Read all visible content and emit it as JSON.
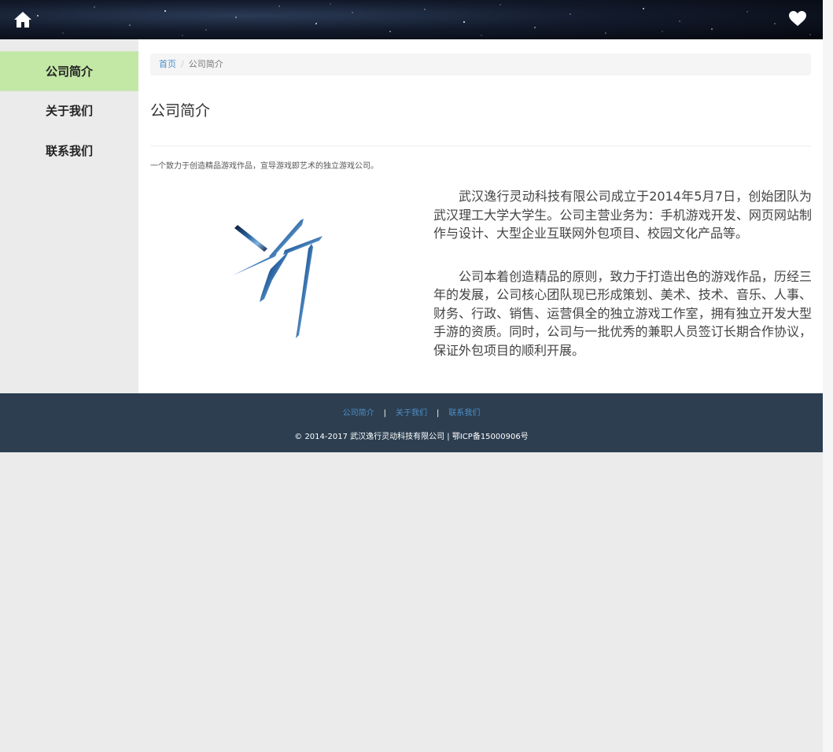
{
  "header": {
    "home_icon": "home-icon",
    "heart_icon": "heart-icon"
  },
  "sidebar": {
    "items": [
      {
        "label": "公司简介",
        "active": true
      },
      {
        "label": "关于我们",
        "active": false
      },
      {
        "label": "联系我们",
        "active": false
      }
    ]
  },
  "breadcrumb": {
    "home": "首页",
    "separator": "/",
    "current": "公司简介"
  },
  "main": {
    "title": "公司简介",
    "tagline": "一个致力于创造精品游戏作品，宣导游戏即艺术的独立游戏公司。",
    "paragraphs": [
      "武汉逸行灵动科技有限公司成立于2014年5月7日，创始团队为武汉理工大学大学生。公司主营业务为：手机游戏开发、网页网站制作与设计、大型企业互联网外包项目、校园文化产品等。",
      "公司本着创造精品的原则，致力于打造出色的游戏作品，历经三年的发展，公司核心团队现已形成策划、美术、技术、音乐、人事、财务、行政、销售、运营俱全的独立游戏工作室，拥有独立开发大型手游的资质。同时，公司与一批优秀的兼职人员签订长期合作协议，保证外包项目的顺利开展。"
    ]
  },
  "footer": {
    "links": [
      "公司简介",
      "关于我们",
      "联系我们"
    ],
    "separator": "|",
    "copyright": "© 2014-2017  武汉逸行灵动科技有限公司  |  鄂ICP备15000906号"
  },
  "colors": {
    "sidebar_active": "#c3e8a6",
    "footer_bg": "#2c3e50",
    "link": "#4d8fc9"
  }
}
